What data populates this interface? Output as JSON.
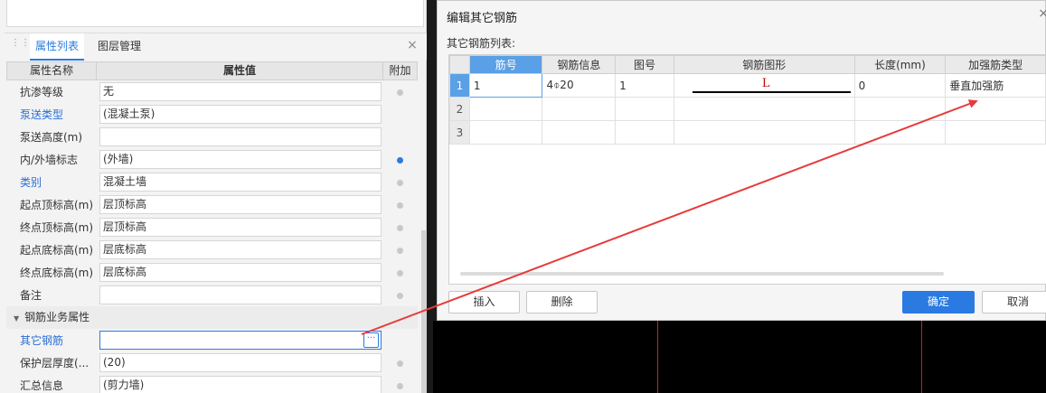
{
  "left_panel": {
    "tabs": [
      "属性列表",
      "图层管理"
    ],
    "close_glyph": "×",
    "grid_header": {
      "name": "属性名称",
      "value": "属性值",
      "add": "附加"
    },
    "rows": [
      {
        "name": "抗渗等级",
        "value": "无",
        "add": "dot"
      },
      {
        "name": "泵送类型",
        "value": "(混凝土泵)",
        "add": "none"
      },
      {
        "name": "泵送高度(m)",
        "value": "",
        "add": "none"
      },
      {
        "name": "内/外墙标志",
        "value": "(外墙)",
        "add": "dot-on"
      },
      {
        "name": "类别",
        "value": "混凝土墙",
        "add": "dot"
      },
      {
        "name": "起点顶标高(m)",
        "value": "层顶标高",
        "add": "dot"
      },
      {
        "name": "终点顶标高(m)",
        "value": "层顶标高",
        "add": "dot"
      },
      {
        "name": "起点底标高(m)",
        "value": "层底标高",
        "add": "dot"
      },
      {
        "name": "终点底标高(m)",
        "value": "层底标高",
        "add": "dot"
      },
      {
        "name": "备注",
        "value": "",
        "add": "dot"
      }
    ],
    "section": "钢筋业务属性",
    "rows2": [
      {
        "name": "其它钢筋",
        "value": "",
        "add": "none"
      },
      {
        "name": "保护层厚度(...",
        "value": "(20)",
        "add": "dot"
      },
      {
        "name": "汇总信息",
        "value": "(剪力墙)",
        "add": "dot"
      }
    ],
    "ellipsis": "···"
  },
  "dialog": {
    "title": "编辑其它钢筋",
    "close_glyph": "×",
    "list_label": "其它钢筋列表:",
    "columns": [
      "筋号",
      "钢筋信息",
      "图号",
      "钢筋图形",
      "长度(mm)",
      "加强筋类型"
    ],
    "rows": [
      {
        "num": "1",
        "bar_no": "1",
        "info": "4⌽20",
        "fig": "1",
        "shape": "L",
        "length": "0",
        "type": "垂直加强筋"
      },
      {
        "num": "2",
        "bar_no": "",
        "info": "",
        "fig": "",
        "shape": "",
        "length": "",
        "type": ""
      },
      {
        "num": "3",
        "bar_no": "",
        "info": "",
        "fig": "",
        "shape": "",
        "length": "",
        "type": ""
      }
    ],
    "buttons": {
      "insert": "插入",
      "delete": "删除",
      "ok": "确定",
      "cancel": "取消"
    }
  },
  "colors": {
    "accent": "#2a7ae2",
    "arrow": "#e83a3a"
  }
}
